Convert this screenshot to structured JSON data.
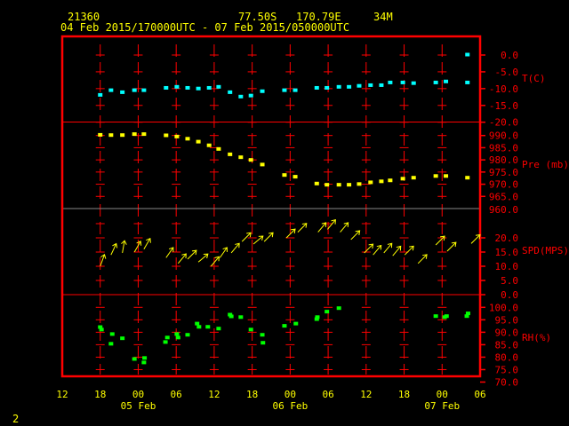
{
  "header": {
    "station_id": "21360",
    "lat": "77.50S",
    "lon": "170.79E",
    "elevation": "34M",
    "time_range": "04 Feb 2015/170000UTC - 07 Feb 2015/050000UTC"
  },
  "footer": {
    "page": "2"
  },
  "colors": {
    "frame": "#ff0000",
    "text_axis": "#ff0000",
    "text_time": "#ffff00",
    "temp": "#00ffff",
    "pressure": "#ffff00",
    "wind": "#ffff00",
    "rh": "#00ff00"
  },
  "chart_data": [
    {
      "type": "scatter",
      "name": "temperature",
      "ylabel": "T(C)",
      "ylim": [
        -20,
        0
      ],
      "yticks": [
        "0.0",
        "-5.0",
        "-10.0",
        "-15.0",
        "-20.0"
      ],
      "x_units": "hours since 04 Feb 12UTC",
      "x": [
        6.0,
        7.7,
        9.5,
        11.4,
        12.9,
        16.4,
        18.1,
        19.8,
        21.5,
        23.2,
        24.7,
        26.5,
        28.2,
        29.8,
        31.6,
        35.1,
        36.8,
        40.2,
        41.8,
        43.7,
        45.3,
        46.9,
        48.7,
        50.4,
        51.8,
        53.8,
        55.5,
        59.0,
        60.6,
        64.0,
        64.0
      ],
      "y": [
        -12.0,
        -10.6,
        -11.2,
        -10.6,
        -10.6,
        -9.9,
        -9.6,
        -9.9,
        -10.1,
        -9.9,
        -9.6,
        -11.2,
        -12.5,
        -12.2,
        -10.9,
        -10.6,
        -10.6,
        -9.9,
        -9.9,
        -9.6,
        -9.6,
        -9.3,
        -9.1,
        -9.1,
        -8.3,
        -8.3,
        -8.5,
        -8.3,
        -8.0,
        -8.3,
        0.0
      ]
    },
    {
      "type": "scatter",
      "name": "pressure",
      "ylabel": "Pre (mb)",
      "ylim": [
        960,
        990
      ],
      "yticks": [
        "990.0",
        "985.0",
        "980.0",
        "975.0",
        "970.0",
        "965.0",
        "960.0"
      ],
      "x": [
        6.0,
        7.7,
        9.5,
        11.4,
        12.9,
        16.4,
        18.1,
        19.8,
        21.5,
        23.2,
        24.7,
        26.5,
        28.2,
        29.8,
        31.6,
        35.1,
        36.8,
        40.2,
        41.8,
        43.7,
        45.3,
        46.9,
        48.7,
        50.4,
        51.8,
        53.8,
        55.5,
        59.0,
        60.6,
        64.0
      ],
      "y": [
        990.1,
        990.0,
        990.0,
        990.4,
        990.4,
        989.9,
        989.4,
        988.5,
        987.3,
        985.8,
        984.3,
        982.1,
        980.9,
        979.8,
        977.9,
        973.6,
        972.9,
        970.1,
        969.6,
        969.6,
        969.6,
        969.9,
        970.6,
        971.0,
        971.4,
        972.1,
        972.5,
        973.2,
        973.2,
        972.5
      ]
    },
    {
      "type": "scatter",
      "name": "wind",
      "ylabel": "SPD(MPS)",
      "ylim": [
        0,
        25
      ],
      "yticks": [
        "25.0",
        "20.0",
        "15.0",
        "10.0",
        "5.0",
        "0.0"
      ],
      "x": [
        6.0,
        7.7,
        9.5,
        11.4,
        12.9,
        16.4,
        18.3,
        19.8,
        21.5,
        23.5,
        24.9,
        26.7,
        28.4,
        30.2,
        31.9,
        35.4,
        37.2,
        40.4,
        41.9,
        43.9,
        45.6,
        47.7,
        49.1,
        50.8,
        52.2,
        54.1,
        56.2,
        59.0,
        60.8,
        64.6
      ],
      "y": [
        10.0,
        14.0,
        14.7,
        15.0,
        16.0,
        13.0,
        11.0,
        12.5,
        11.5,
        10.0,
        13.0,
        14.7,
        18.7,
        17.8,
        18.7,
        20.0,
        22.0,
        22.0,
        23.0,
        22.0,
        19.4,
        14.7,
        14.0,
        14.7,
        13.7,
        14.0,
        11.0,
        17.5,
        15.3,
        18.0
      ],
      "direction_toward_deg": [
        20,
        25,
        10,
        30,
        30,
        35,
        40,
        45,
        50,
        40,
        35,
        40,
        45,
        50,
        45,
        45,
        45,
        40,
        40,
        40,
        45,
        45,
        40,
        40,
        40,
        45,
        45,
        45,
        45,
        45
      ]
    },
    {
      "type": "scatter",
      "name": "relative_humidity",
      "ylabel": "RH(%)",
      "ylim": [
        70,
        100
      ],
      "yticks": [
        "100.0",
        "95.0",
        "90.0",
        "85.0",
        "80.0",
        "75.0",
        "70.0"
      ],
      "x": [
        6.0,
        6.2,
        7.9,
        7.7,
        9.5,
        11.4,
        13.0,
        12.9,
        16.3,
        16.6,
        18.1,
        18.3,
        19.8,
        21.3,
        21.6,
        23.0,
        24.7,
        26.5,
        26.7,
        28.2,
        29.8,
        31.6,
        31.7,
        35.1,
        36.9,
        40.2,
        40.3,
        41.8,
        43.7,
        59.0,
        60.4,
        60.7,
        63.9,
        64.1
      ],
      "y": [
        91.9,
        90.9,
        89.1,
        85.2,
        87.4,
        79.1,
        79.5,
        77.7,
        85.9,
        87.7,
        89.1,
        87.7,
        88.8,
        93.3,
        92.0,
        92.0,
        91.3,
        96.9,
        96.2,
        95.9,
        90.9,
        88.8,
        85.6,
        92.4,
        93.3,
        95.1,
        95.9,
        98.1,
        99.5,
        96.3,
        95.9,
        96.3,
        96.3,
        97.4
      ]
    }
  ],
  "time_axis": {
    "tick_labels": [
      "12",
      "18",
      "00",
      "06",
      "12",
      "18",
      "00",
      "06",
      "12",
      "18",
      "00",
      "06"
    ],
    "date_labels": [
      {
        "label": "05 Feb",
        "tick": 2
      },
      {
        "label": "06 Feb",
        "tick": 6
      },
      {
        "label": "07 Feb",
        "tick": 10
      }
    ]
  }
}
